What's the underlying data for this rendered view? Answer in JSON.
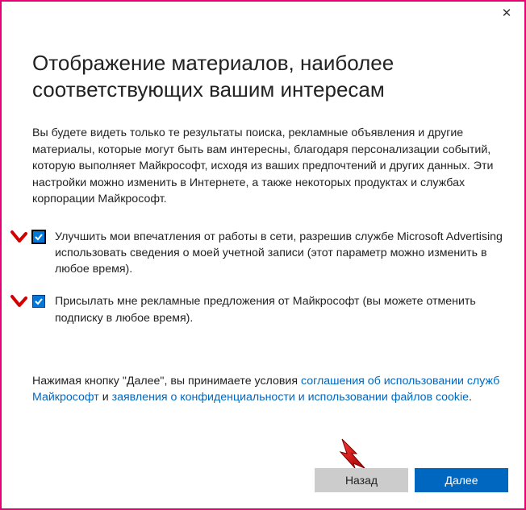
{
  "title": "Отображение материалов, наиболее соответствующих вашим интересам",
  "lead": "Вы будете видеть только те результаты поиска, рекламные объявления и другие материалы, которые могут быть вам интересны, благодаря персонализации событий, которую выполняет Майкрософт, исходя из ваших предпочтений и других данных. Эти настройки можно изменить в Интернете, а также некоторых продуктах и службах корпорации Майкрософт.",
  "options": [
    {
      "text": "Улучшить мои впечатления от работы в сети, разрешив службе Microsoft Advertising использовать сведения о моей учетной записи (этот параметр можно изменить в любое время)."
    },
    {
      "text": "Присылать мне рекламные предложения от Майкрософт (вы можете отменить подписку в любое время)."
    }
  ],
  "legal": {
    "prefix": "Нажимая кнопку \"Далее\", вы принимаете условия ",
    "link1": "соглашения об использовании служб Майкрософт",
    "mid": " и ",
    "link2": "заявления о конфиденциальности и использовании файлов cookie",
    "suffix": "."
  },
  "buttons": {
    "back": "Назад",
    "next": "Далее"
  }
}
